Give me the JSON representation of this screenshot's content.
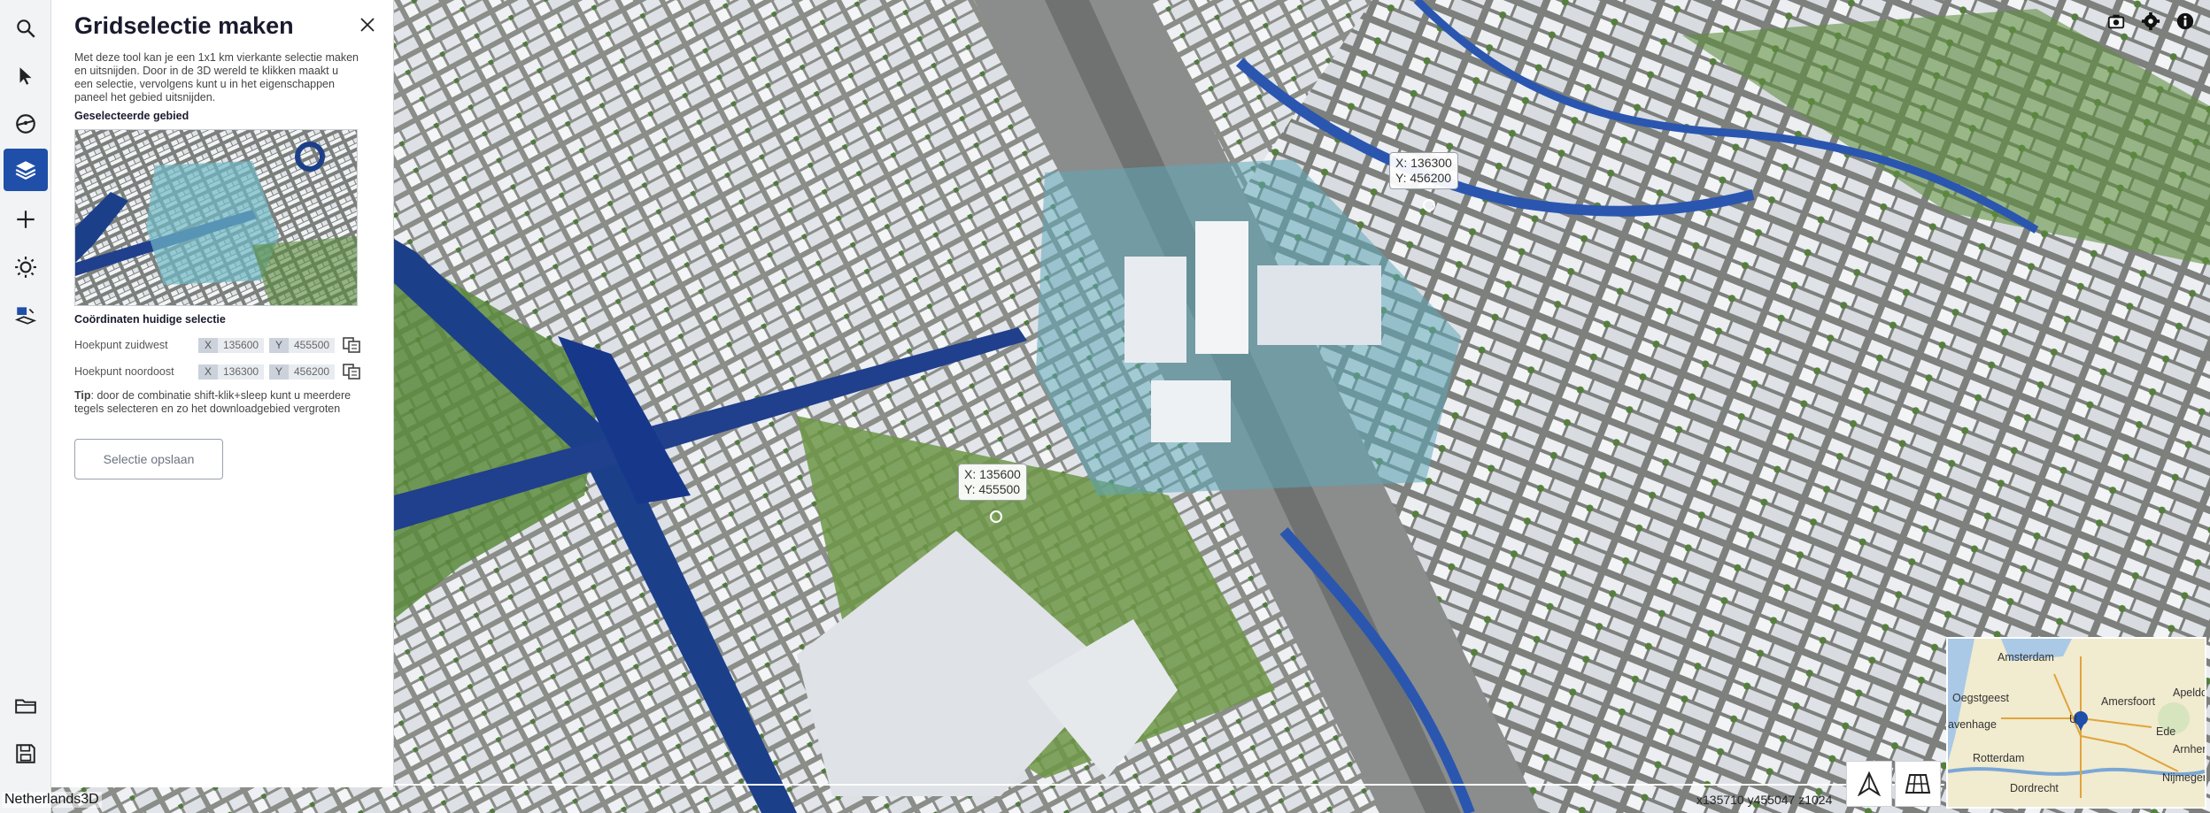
{
  "app": {
    "name": "Netherlands3D"
  },
  "toolbar": {
    "items": [
      {
        "icon": "search-icon"
      },
      {
        "icon": "pointer-icon"
      },
      {
        "icon": "measure-icon"
      },
      {
        "icon": "layers-icon",
        "active": true
      },
      {
        "icon": "plus-icon"
      },
      {
        "icon": "sun-icon"
      },
      {
        "icon": "grid-select-icon"
      }
    ],
    "bottom": [
      {
        "icon": "folder-icon"
      },
      {
        "icon": "save-icon"
      }
    ]
  },
  "panel": {
    "title": "Gridselectie maken",
    "description": "Met deze tool kan je een 1x1 km vierkante selectie maken en uitsnijden. Door in de 3D wereld te klikken maakt u een selectie, vervolgens kunt u in het eigenschappen paneel het gebied uitsnijden.",
    "selected_area_label": "Geselecteerde gebied",
    "coords_label": "Coördinaten huidige selectie",
    "southwest": {
      "label": "Hoekpunt zuidwest",
      "x_axis": "X",
      "x": "135600",
      "y_axis": "Y",
      "y": "455500"
    },
    "northeast": {
      "label": "Hoekpunt noordoost",
      "x_axis": "X",
      "x": "136300",
      "y_axis": "Y",
      "y": "456200"
    },
    "tip_bold": "Tip",
    "tip_text": ": door de combinatie shift-klik+sleep kunt u meerdere tegels selecteren en zo het downloadgebied vergroten",
    "save_label": "Selectie opslaan"
  },
  "map": {
    "tip_ne": {
      "x": "X: 136300",
      "y": "Y: 456200"
    },
    "tip_sw": {
      "x": "X: 135600",
      "y": "Y: 455500"
    },
    "camera_readout": "x135710 y455047 z1024",
    "accent": "#1f4fa8",
    "selection_color": "#5fa8b8"
  },
  "minimap": {
    "labels": [
      "Amsterdam",
      "Oegstgeest",
      "Amersfoort",
      "Apeldo",
      "avenhage",
      "U",
      "Ede",
      "Arnhem",
      "Rotterdam",
      "Dordrecht",
      "Nijmegen"
    ]
  },
  "top_right": [
    {
      "icon": "camera-icon"
    },
    {
      "icon": "gear-icon"
    },
    {
      "icon": "info-icon"
    }
  ]
}
